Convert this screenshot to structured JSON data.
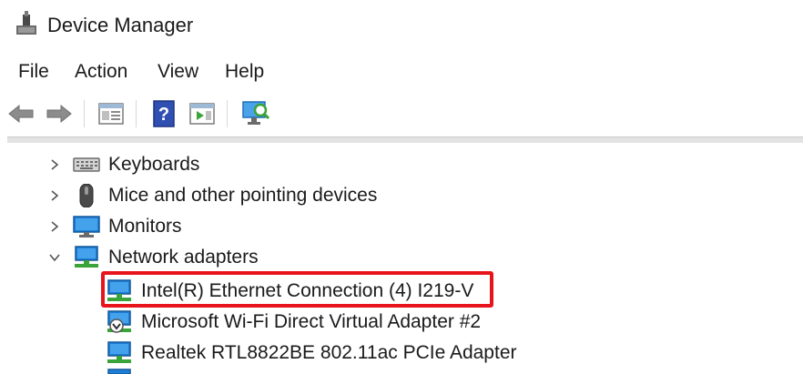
{
  "window": {
    "title": "Device Manager"
  },
  "menu": {
    "items": [
      {
        "label": "File"
      },
      {
        "label": "Action"
      },
      {
        "label": "View"
      },
      {
        "label": "Help"
      }
    ]
  },
  "toolbar": {
    "buttons": [
      {
        "icon": "back-arrow-icon"
      },
      {
        "icon": "forward-arrow-icon"
      },
      {
        "icon": "properties-icon"
      },
      {
        "icon": "help-icon"
      },
      {
        "icon": "run-icon"
      },
      {
        "icon": "scan-hardware-icon"
      }
    ]
  },
  "tree": {
    "categories": [
      {
        "label": "Keyboards",
        "expanded": false,
        "icon": "keyboard-icon"
      },
      {
        "label": "Mice and other pointing devices",
        "expanded": false,
        "icon": "mouse-icon"
      },
      {
        "label": "Monitors",
        "expanded": false,
        "icon": "monitor-icon"
      },
      {
        "label": "Network adapters",
        "expanded": true,
        "icon": "network-adapter-icon"
      }
    ],
    "network_adapters": [
      {
        "label": "Intel(R) Ethernet Connection (4) I219-V",
        "icon": "network-adapter-icon",
        "highlighted": true
      },
      {
        "label": "Microsoft Wi-Fi Direct Virtual Adapter #2",
        "icon": "network-adapter-disabled-icon",
        "highlighted": false
      },
      {
        "label": "Realtek RTL8822BE 802.11ac PCIe Adapter",
        "icon": "network-adapter-icon",
        "highlighted": false
      }
    ]
  },
  "colors": {
    "highlight_border": "#e8141b",
    "adapter_green": "#3aa33a",
    "monitor_blue": "#1e7fd8"
  }
}
